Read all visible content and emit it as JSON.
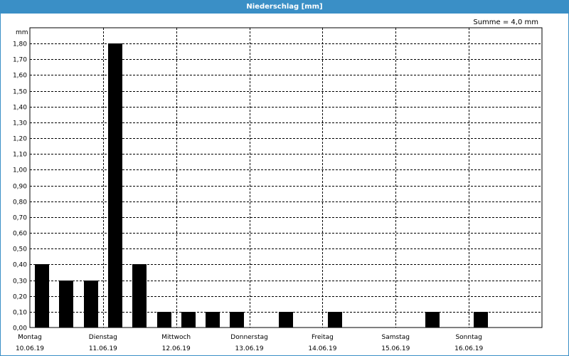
{
  "window": {
    "title": "Niederschlag [mm]"
  },
  "summary": "Summe = 4,0 mm",
  "chart_data": {
    "type": "bar",
    "title": "Niederschlag [mm]",
    "ylabel": "mm",
    "xlabel": "",
    "ylim": [
      0,
      1.9
    ],
    "grid": true,
    "yticks": [
      0,
      0.1,
      0.2,
      0.3,
      0.4,
      0.5,
      0.6,
      0.7,
      0.8,
      0.9,
      1.0,
      1.1,
      1.2,
      1.3,
      1.4,
      1.5,
      1.6,
      1.7,
      1.8
    ],
    "ytick_labels": [
      "0,00",
      "0,10",
      "0,20",
      "0,30",
      "0,40",
      "0,50",
      "0,60",
      "0,70",
      "0,80",
      "0,90",
      "1,00",
      "1,10",
      "1,20",
      "1,30",
      "1,40",
      "1,50",
      "1,60",
      "1,70",
      "1,80"
    ],
    "days": [
      {
        "name": "Montag",
        "date": "10.06.19"
      },
      {
        "name": "Dienstag",
        "date": "11.06.19"
      },
      {
        "name": "Mittwoch",
        "date": "12.06.19"
      },
      {
        "name": "Donnerstag",
        "date": "13.06.19"
      },
      {
        "name": "Freitag",
        "date": "14.06.19"
      },
      {
        "name": "Samstag",
        "date": "15.06.19"
      },
      {
        "name": "Sonntag",
        "date": "16.06.19"
      }
    ],
    "bins_per_day": 3,
    "values": [
      0.4,
      0.3,
      0.3,
      1.8,
      0.4,
      0.1,
      0.1,
      0.1,
      0.1,
      0,
      0.1,
      0,
      0.1,
      0,
      0,
      0,
      0.1,
      0,
      0.1,
      0,
      0
    ]
  }
}
